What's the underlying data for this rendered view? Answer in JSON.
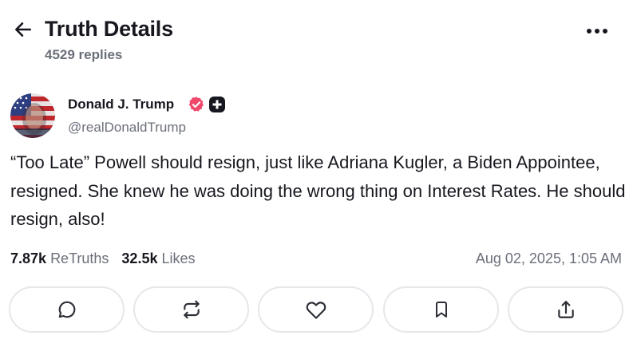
{
  "header": {
    "title": "Truth Details",
    "replies": "4529 replies"
  },
  "post": {
    "display_name": "Donald J. Trump",
    "handle": "@realDonaldTrump",
    "text": "“Too Late” Powell should resign, just like Adriana Kugler, a Biden Appointee, resigned. She knew he was doing the wrong thing on Interest Rates. He should resign, also!",
    "retruths_count": "7.87k",
    "retruths_label": "ReTruths",
    "likes_count": "32.5k",
    "likes_label": "Likes",
    "timestamp": "Aug 02, 2025, 1:05 AM"
  },
  "icons": {
    "back": "arrow-left-icon",
    "more": "more-horizontal-icon",
    "verified": "verified-badge-icon",
    "plus": "plus-badge-icon",
    "actions": [
      "comment-icon",
      "retruth-icon",
      "heart-icon",
      "bookmark-icon",
      "share-icon"
    ]
  },
  "colors": {
    "verified": "#f0486a",
    "text": "#17171f",
    "muted": "#6b6f7a",
    "border": "#e6e7eb"
  }
}
